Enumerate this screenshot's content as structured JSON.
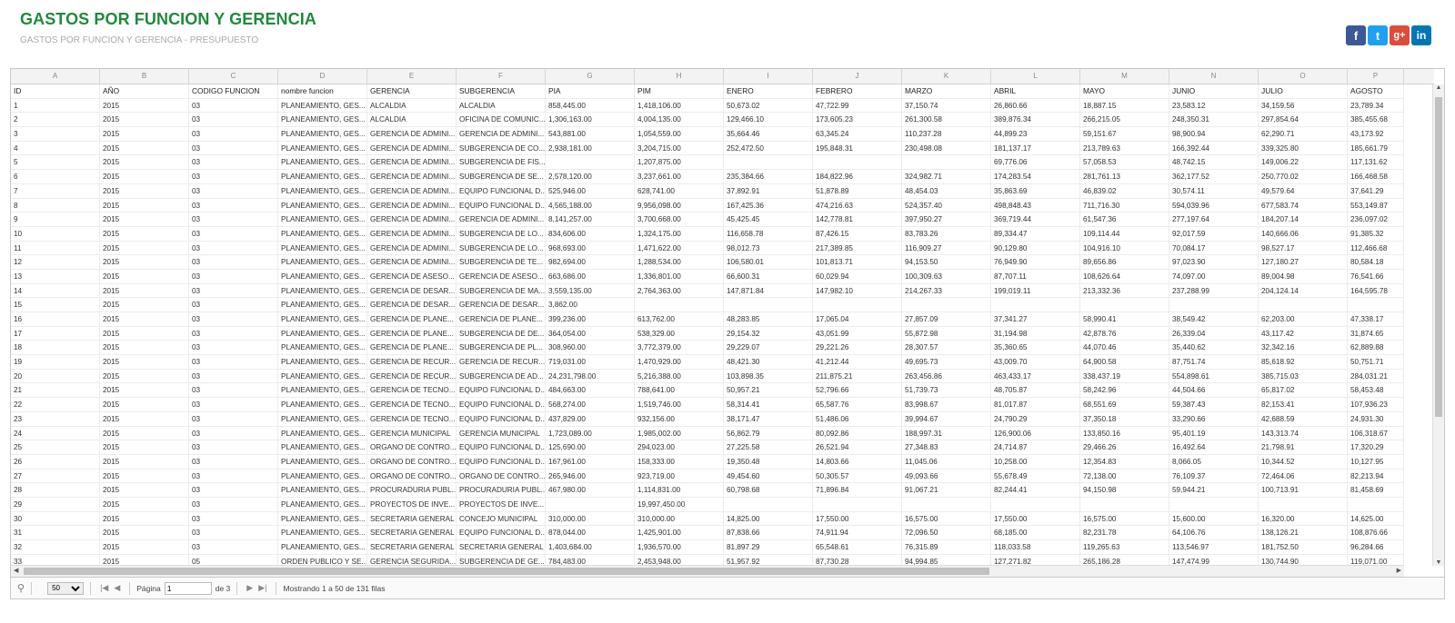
{
  "page": {
    "title": "GASTOS POR FUNCION Y GERENCIA",
    "subtitle": "GASTOS POR FUNCION Y GERENCIA - PRESUPUESTO"
  },
  "social": [
    {
      "name": "facebook-icon",
      "glyph": "f",
      "cls": "fb"
    },
    {
      "name": "twitter-icon",
      "glyph": "t",
      "cls": "tw"
    },
    {
      "name": "google-plus-icon",
      "glyph": "g+",
      "cls": "gp"
    },
    {
      "name": "linkedin-icon",
      "glyph": "in",
      "cls": "li"
    }
  ],
  "columns": {
    "letters": [
      "A",
      "B",
      "C",
      "D",
      "E",
      "F",
      "G",
      "H",
      "I",
      "J",
      "K",
      "L",
      "M",
      "N",
      "O",
      "P"
    ],
    "headers": [
      "ID",
      "AÑO",
      "CODIGO FUNCION",
      "nombre funcion",
      "GERENCIA",
      "SUBGERENCIA",
      "PIA",
      "PIM",
      "ENERO",
      "FEBRERO",
      "MARZO",
      "ABRIL",
      "MAYO",
      "JUNIO",
      "JULIO",
      "AGOSTO"
    ]
  },
  "rows": [
    [
      "1",
      "2015",
      "03",
      "PLANEAMIENTO, GES...",
      "ALCALDIA",
      "ALCALDIA",
      "858,445.00",
      "1,418,106.00",
      "50,673.02",
      "47,722.99",
      "37,150.74",
      "26,860.66",
      "18,887.15",
      "23,583.12",
      "34,159.56",
      "23,789.34"
    ],
    [
      "2",
      "2015",
      "03",
      "PLANEAMIENTO, GES...",
      "ALCALDIA",
      "OFICINA DE COMUNIC...",
      "1,306,163.00",
      "4,004,135.00",
      "129,466.10",
      "173,605.23",
      "261,300.58",
      "389,876.34",
      "266,215.05",
      "248,350.31",
      "297,854.64",
      "385,455.68"
    ],
    [
      "3",
      "2015",
      "03",
      "PLANEAMIENTO, GES...",
      "GERENCIA DE ADMINI...",
      "GERENCIA DE ADMINI...",
      "543,881.00",
      "1,054,559.00",
      "35,664.46",
      "63,345.24",
      "110,237.28",
      "44,899.23",
      "59,151.67",
      "98,900.94",
      "62,290.71",
      "43,173.92"
    ],
    [
      "4",
      "2015",
      "03",
      "PLANEAMIENTO, GES...",
      "GERENCIA DE ADMINI...",
      "SUBGERENCIA DE CO...",
      "2,938,181.00",
      "3,204,715.00",
      "252,472.50",
      "195,848.31",
      "230,498.08",
      "181,137.17",
      "213,789.63",
      "166,392.44",
      "339,325.80",
      "185,661.79"
    ],
    [
      "5",
      "2015",
      "03",
      "PLANEAMIENTO, GES...",
      "GERENCIA DE ADMINI...",
      "SUBGERENCIA DE FIS...",
      "",
      "1,207,875.00",
      "",
      "",
      "",
      "69,776.06",
      "57,058.53",
      "48,742.15",
      "149,006.22",
      "117,131.62"
    ],
    [
      "6",
      "2015",
      "03",
      "PLANEAMIENTO, GES...",
      "GERENCIA DE ADMINI...",
      "SUBGERENCIA DE SE...",
      "2,578,120.00",
      "3,237,661.00",
      "235,384.66",
      "184,822.96",
      "324,982.71",
      "174,283.54",
      "281,761.13",
      "362,177.52",
      "250,770.02",
      "166,468.58"
    ],
    [
      "7",
      "2015",
      "03",
      "PLANEAMIENTO, GES...",
      "GERENCIA DE ADMINI...",
      "EQUIPO FUNCIONAL D...",
      "525,946.00",
      "628,741.00",
      "37,892.91",
      "51,878.89",
      "48,454.03",
      "35,863.69",
      "46,839.02",
      "30,574.11",
      "49,579.64",
      "37,641.29"
    ],
    [
      "8",
      "2015",
      "03",
      "PLANEAMIENTO, GES...",
      "GERENCIA DE ADMINI...",
      "EQUIPO FUNCIONAL D...",
      "4,565,188.00",
      "9,956,098.00",
      "167,425.36",
      "474,216.63",
      "524,357.40",
      "498,848.43",
      "711,716.30",
      "594,039.96",
      "677,583.74",
      "553,149.87"
    ],
    [
      "9",
      "2015",
      "03",
      "PLANEAMIENTO, GES...",
      "GERENCIA DE ADMINI...",
      "GERENCIA DE ADMINI...",
      "8,141,257.00",
      "3,700,668.00",
      "45,425.45",
      "142,778.81",
      "397,950.27",
      "369,719.44",
      "61,547.36",
      "277,197.64",
      "184,207.14",
      "236,097.02"
    ],
    [
      "10",
      "2015",
      "03",
      "PLANEAMIENTO, GES...",
      "GERENCIA DE ADMINI...",
      "SUBGERENCIA DE LO...",
      "834,606.00",
      "1,324,175.00",
      "116,658.78",
      "87,426.15",
      "83,783.26",
      "89,334.47",
      "109,114.44",
      "92,017.59",
      "140,666.06",
      "91,385.32"
    ],
    [
      "11",
      "2015",
      "03",
      "PLANEAMIENTO, GES...",
      "GERENCIA DE ADMINI...",
      "SUBGERENCIA DE LO...",
      "968,693.00",
      "1,471,622.00",
      "98,012.73",
      "217,389.85",
      "116,909.27",
      "90,129.80",
      "104,916.10",
      "70,084.17",
      "98,527.17",
      "112,466.68"
    ],
    [
      "12",
      "2015",
      "03",
      "PLANEAMIENTO, GES...",
      "GERENCIA DE ADMINI...",
      "SUBGERENCIA DE TE...",
      "982,694.00",
      "1,288,534.00",
      "106,580.01",
      "101,813.71",
      "94,153.50",
      "76,949.90",
      "89,656.86",
      "97,023.90",
      "127,180.27",
      "80,584.18"
    ],
    [
      "13",
      "2015",
      "03",
      "PLANEAMIENTO, GES...",
      "GERENCIA DE ASESO...",
      "GERENCIA DE ASESO...",
      "663,686.00",
      "1,336,801.00",
      "66,600.31",
      "60,029.94",
      "100,309.63",
      "87,707.11",
      "108,626.64",
      "74,097.00",
      "89,004.98",
      "76,541.66"
    ],
    [
      "14",
      "2015",
      "03",
      "PLANEAMIENTO, GES...",
      "GERENCIA DE DESAR...",
      "SUBGERENCIA DE MA...",
      "3,559,135.00",
      "2,764,363.00",
      "147,871.84",
      "147,982.10",
      "214,267.33",
      "199,019.11",
      "213,332.36",
      "237,288.99",
      "204,124.14",
      "164,595.78"
    ],
    [
      "15",
      "2015",
      "03",
      "PLANEAMIENTO, GES...",
      "GERENCIA DE DESAR...",
      "GERENCIA DE DESAR...",
      "3,862.00",
      "",
      "",
      "",
      "",
      "",
      "",
      "",
      "",
      ""
    ],
    [
      "16",
      "2015",
      "03",
      "PLANEAMIENTO, GES...",
      "GERENCIA DE PLANE...",
      "GERENCIA DE PLANE...",
      "399,236.00",
      "613,762.00",
      "48,283.85",
      "17,065.04",
      "27,857.09",
      "37,341.27",
      "58,990.41",
      "38,549.42",
      "62,203.00",
      "47,338.17"
    ],
    [
      "17",
      "2015",
      "03",
      "PLANEAMIENTO, GES...",
      "GERENCIA DE PLANE...",
      "SUBGERENCIA DE DE...",
      "364,054.00",
      "538,329.00",
      "29,154.32",
      "43,051.99",
      "55,872.98",
      "31,194.98",
      "42,878.76",
      "26,339.04",
      "43,117.42",
      "31,874.65"
    ],
    [
      "18",
      "2015",
      "03",
      "PLANEAMIENTO, GES...",
      "GERENCIA DE PLANE...",
      "SUBGERENCIA DE PL...",
      "308,960.00",
      "3,772,379.00",
      "29,229.07",
      "29,221.26",
      "28,307.57",
      "35,360.65",
      "44,070.46",
      "35,440.62",
      "32,342.16",
      "62,889.88"
    ],
    [
      "19",
      "2015",
      "03",
      "PLANEAMIENTO, GES...",
      "GERENCIA DE RECUR...",
      "GERENCIA DE RECUR...",
      "719,031.00",
      "1,470,929.00",
      "48,421.30",
      "41,212.44",
      "49,695.73",
      "43,009.70",
      "64,900.58",
      "87,751.74",
      "85,618.92",
      "50,751.71"
    ],
    [
      "20",
      "2015",
      "03",
      "PLANEAMIENTO, GES...",
      "GERENCIA DE RECUR...",
      "SUBGERENCIA DE AD...",
      "24,231,798.00",
      "5,216,388.00",
      "103,898.35",
      "211,875.21",
      "263,456.86",
      "463,433.17",
      "338,437.19",
      "554,898.61",
      "385,715.03",
      "284,031.21"
    ],
    [
      "21",
      "2015",
      "03",
      "PLANEAMIENTO, GES...",
      "GERENCIA DE TECNO...",
      "EQUIPO FUNCIONAL D...",
      "484,663.00",
      "788,641.00",
      "50,957.21",
      "52,796.66",
      "51,739.73",
      "48,705.87",
      "58,242.96",
      "44,504.66",
      "65,817.02",
      "58,453.48"
    ],
    [
      "22",
      "2015",
      "03",
      "PLANEAMIENTO, GES...",
      "GERENCIA DE TECNO...",
      "EQUIPO FUNCIONAL D...",
      "568,274.00",
      "1,519,746.00",
      "58,314.41",
      "65,587.76",
      "83,998.67",
      "81,017.87",
      "68,551.69",
      "59,387.43",
      "82,153.41",
      "107,936.23"
    ],
    [
      "23",
      "2015",
      "03",
      "PLANEAMIENTO, GES...",
      "GERENCIA DE TECNO...",
      "EQUIPO FUNCIONAL D...",
      "437,829.00",
      "932,156.00",
      "38,171.47",
      "51,486.06",
      "39,994.67",
      "24,790.29",
      "37,350.18",
      "33,290.66",
      "42,688.59",
      "24,931.30"
    ],
    [
      "24",
      "2015",
      "03",
      "PLANEAMIENTO, GES...",
      "GERENCIA MUNICIPAL",
      "GERENCIA MUNICIPAL",
      "1,723,089.00",
      "1,985,002.00",
      "56,862.79",
      "80,092.86",
      "188,997.31",
      "126,900.06",
      "133,850.16",
      "95,401.19",
      "143,313.74",
      "106,318.67"
    ],
    [
      "25",
      "2015",
      "03",
      "PLANEAMIENTO, GES...",
      "ORGANO DE CONTRO...",
      "EQUIPO FUNCIONAL D...",
      "125,690.00",
      "294,023.00",
      "27,225.58",
      "26,521.94",
      "27,348.83",
      "24,714.87",
      "29,466.26",
      "16,492.64",
      "21,798.91",
      "17,320.29"
    ],
    [
      "26",
      "2015",
      "03",
      "PLANEAMIENTO, GES...",
      "ORGANO DE CONTRO...",
      "EQUIPO FUNCIONAL D...",
      "167,961.00",
      "158,333.00",
      "19,350.48",
      "14,803.66",
      "11,045.06",
      "10,258.00",
      "12,354.83",
      "8,066.05",
      "10,344.52",
      "10,127.95"
    ],
    [
      "27",
      "2015",
      "03",
      "PLANEAMIENTO, GES...",
      "ORGANO DE CONTRO...",
      "ORGANO DE CONTRO...",
      "265,946.00",
      "923,719.00",
      "49,454.60",
      "50,305.57",
      "49,093.66",
      "55,678.49",
      "72,138.00",
      "76,109.37",
      "72,464.06",
      "82,213.94"
    ],
    [
      "28",
      "2015",
      "03",
      "PLANEAMIENTO, GES...",
      "PROCURADURIA PUBL...",
      "PROCURADURIA PUBL...",
      "467,980.00",
      "1,114,831.00",
      "60,798.68",
      "71,896.84",
      "91,067.21",
      "82,244.41",
      "94,150.98",
      "59,944.21",
      "100,713.91",
      "81,458.69"
    ],
    [
      "29",
      "2015",
      "03",
      "PLANEAMIENTO, GES...",
      "PROYECTOS DE INVE...",
      "PROYECTOS DE INVE...",
      "",
      "19,997,450.00",
      "",
      "",
      "",
      "",
      "",
      "",
      "",
      ""
    ],
    [
      "30",
      "2015",
      "03",
      "PLANEAMIENTO, GES...",
      "SECRETARIA GENERAL",
      "CONCEJO MUNICIPAL",
      "310,000.00",
      "310,000.00",
      "14,825.00",
      "17,550.00",
      "16,575.00",
      "17,550.00",
      "16,575.00",
      "15,600.00",
      "16,320.00",
      "14,625.00"
    ],
    [
      "31",
      "2015",
      "03",
      "PLANEAMIENTO, GES...",
      "SECRETARIA GENERAL",
      "EQUIPO FUNCIONAL D...",
      "878,044.00",
      "1,425,901.00",
      "87,838.66",
      "74,911.94",
      "72,096.50",
      "68,185.00",
      "82,231.78",
      "64,106.76",
      "138,126.21",
      "108,876.66"
    ],
    [
      "32",
      "2015",
      "03",
      "PLANEAMIENTO, GES...",
      "SECRETARIA GENERAL",
      "SECRETARIA GENERAL",
      "1,403,684.00",
      "1,936,570.00",
      "81,897.29",
      "65,548.61",
      "76,315.89",
      "118,033.58",
      "119,265.63",
      "113,546.97",
      "181,752.50",
      "96,284.66"
    ],
    [
      "33",
      "2015",
      "05",
      "ORDEN PUBLICO Y SE...",
      "GERENCIA SEGURIDA...",
      "SUBGERENCIA DE GE...",
      "784,483.00",
      "2,453,948.00",
      "51,957.92",
      "87,730.28",
      "94,994.85",
      "127,271.82",
      "265,186.28",
      "147,474.99",
      "130,744.90",
      "119,071.00"
    ]
  ],
  "pager": {
    "page_size": "50",
    "page_label": "Página",
    "page_value": "1",
    "of_label": "de 3",
    "status": "Mostrando 1 a 50 de 131 filas"
  }
}
